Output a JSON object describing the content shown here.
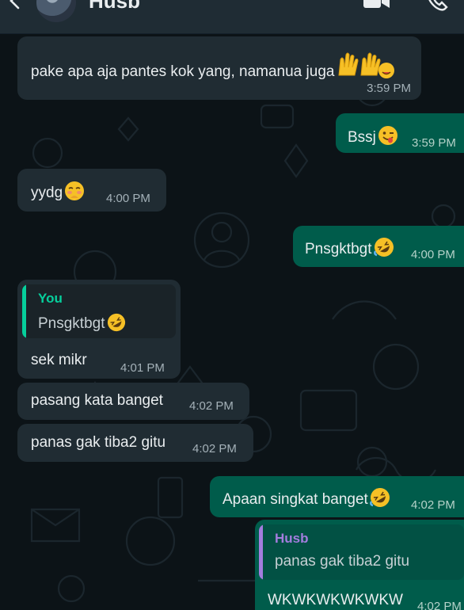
{
  "header": {
    "contact_name": "Husb",
    "icons": [
      "back-arrow-icon",
      "video-call-icon",
      "phone-icon"
    ]
  },
  "colors": {
    "incoming_bubble": "#202c33",
    "outgoing_bubble": "#005c4b",
    "you_label": "#06cf9c",
    "husb_label": "#a37dde"
  },
  "messages": [
    {
      "dir": "in",
      "text": "pake apa aja pantes kok yang, namanua juga",
      "time": "3:59 PM",
      "emoji": "raising-hands-and-winking-tongue-emoji"
    },
    {
      "dir": "out",
      "text": "Bssj",
      "time": "3:59 PM",
      "emoji": "winking-tongue-emoji"
    },
    {
      "dir": "in",
      "text": "yydg",
      "time": "4:00 PM",
      "emoji": "shy-face-emoji"
    },
    {
      "dir": "out",
      "text": "Pnsgktbgt",
      "time": "4:00 PM",
      "emoji": "rolling-laughing-emoji"
    },
    {
      "dir": "in",
      "quote_author": "You",
      "quote_text": "Pnsgktbgt",
      "text": "sek mikr",
      "time": "4:01 PM"
    },
    {
      "dir": "in",
      "text": "pasang kata banget",
      "time": "4:02 PM"
    },
    {
      "dir": "in",
      "text": "panas gak tiba2 gitu",
      "time": "4:02 PM"
    },
    {
      "dir": "out",
      "text": "Apaan singkat banget",
      "time": "4:02 PM",
      "emoji": "rolling-laughing-emoji"
    },
    {
      "dir": "out",
      "quote_author": "Husb",
      "quote_text": "panas gak tiba2 gitu",
      "text": "WKWKWKWKWKW",
      "time": "4:02 PM"
    }
  ]
}
